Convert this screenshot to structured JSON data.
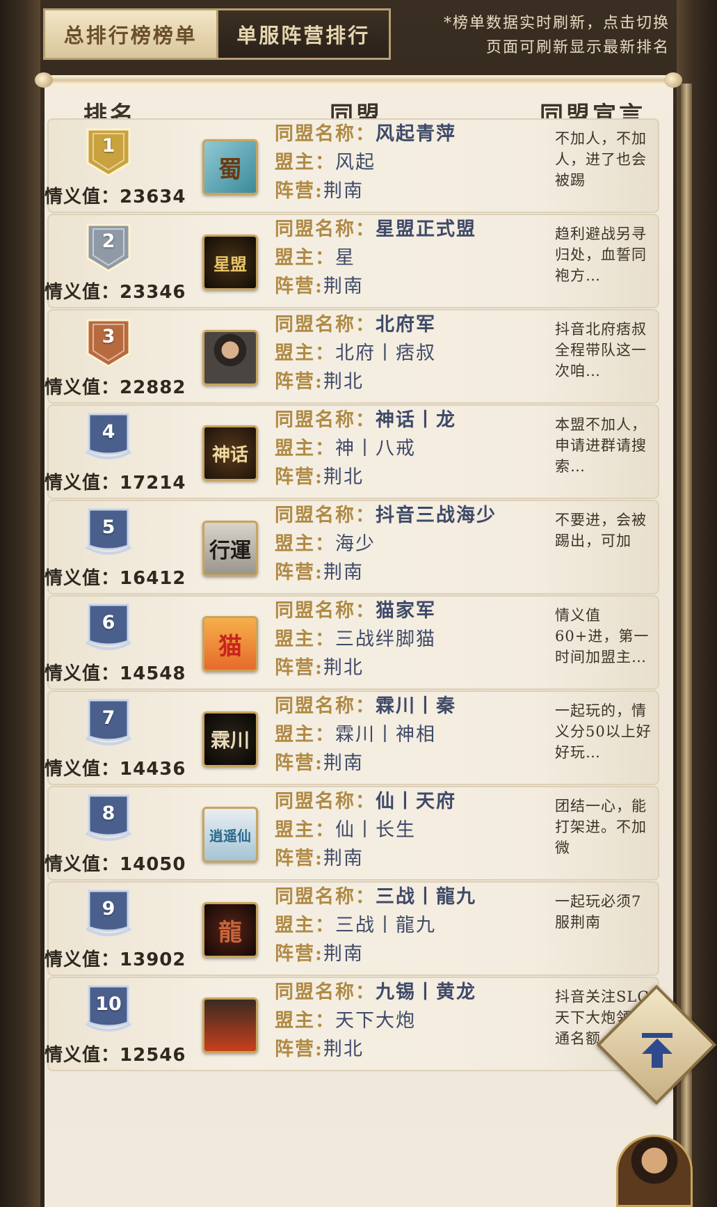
{
  "tabs": [
    {
      "label": "总排行榜榜单",
      "active": true
    },
    {
      "label": "单服阵营排行",
      "active": false
    }
  ],
  "notice_lines": [
    "*榜单数据实时刷新，点击切换",
    "页面可刷新显示最新排名"
  ],
  "columns": {
    "rank": "排名",
    "alliance": "同盟",
    "declaration": "同盟宣言"
  },
  "labels": {
    "score": "情义值：",
    "name": "同盟名称：",
    "leader": "盟主：",
    "camp": "阵营:"
  },
  "rows": [
    {
      "rank": "1",
      "score": "23634",
      "name": "风起青萍",
      "leader": "风起",
      "camp": "荆南",
      "avatar_text": "蜀",
      "avatar_icon": "shu-emblem-icon",
      "declaration": "不加人，不加人，进了也会被踢",
      "badge_color": "#c9a23e"
    },
    {
      "rank": "2",
      "score": "23346",
      "name": "星盟正式盟",
      "leader": "星",
      "camp": "荆南",
      "avatar_text": "星盟",
      "avatar_icon": "phoenix-emblem-icon",
      "declaration": "趋利避战另寻归处，血誓同袍方…",
      "badge_color": "#8f9aa6"
    },
    {
      "rank": "3",
      "score": "22882",
      "name": "北府军",
      "leader": "北府丨痞叔",
      "camp": "荆北",
      "avatar_text": "",
      "avatar_icon": "portrait-avatar-icon",
      "declaration": "抖音北府痞叔全程带队这一次咱…",
      "badge_color": "#b86a3f"
    },
    {
      "rank": "4",
      "score": "17214",
      "name": "神话丨龙",
      "leader": "神丨八戒",
      "camp": "荆北",
      "avatar_text": "神话",
      "avatar_icon": "shenhua-emblem-icon",
      "declaration": "本盟不加人，申请进群请搜索…",
      "badge_color": "#4a5f8c"
    },
    {
      "rank": "5",
      "score": "16412",
      "name": "抖音三战海少",
      "leader": "海少",
      "camp": "荆南",
      "avatar_text": "行運",
      "avatar_icon": "calligraphy-emblem-icon",
      "declaration": "不要进，会被踢出，可加",
      "badge_color": "#4a5f8c"
    },
    {
      "rank": "6",
      "score": "14548",
      "name": "猫家军",
      "leader": "三战绊脚猫",
      "camp": "荆北",
      "avatar_text": "猫",
      "avatar_icon": "cat-emblem-icon",
      "declaration": "情义值60+进，第一时间加盟主…",
      "badge_color": "#4a5f8c"
    },
    {
      "rank": "7",
      "score": "14436",
      "name": "霖川丨秦",
      "leader": "霖川丨神相",
      "camp": "荆南",
      "avatar_text": "霖川",
      "avatar_icon": "linchuan-emblem-icon",
      "declaration": "一起玩的，情义分50以上好好玩…",
      "badge_color": "#4a5f8c"
    },
    {
      "rank": "8",
      "score": "14050",
      "name": "仙丨天府",
      "leader": "仙丨长生",
      "camp": "荆南",
      "avatar_text": "逍遥仙",
      "avatar_icon": "xiaoyao-emblem-icon",
      "declaration": "团结一心，能打架进。不加微",
      "badge_color": "#4a5f8c"
    },
    {
      "rank": "9",
      "score": "13902",
      "name": "三战丨龍九",
      "leader": "三战丨龍九",
      "camp": "荆南",
      "avatar_text": "龍",
      "avatar_icon": "dragon-emblem-icon",
      "declaration": "一起玩必须7服荆南",
      "badge_color": "#4a5f8c"
    },
    {
      "rank": "10",
      "score": "12546",
      "name": "九锡丨黄龙",
      "leader": "天下大炮",
      "camp": "荆北",
      "avatar_text": "",
      "avatar_icon": "banner-fire-icon",
      "declaration": "抖音关注SLG天下大炮领绿通名额…",
      "badge_color": "#4a5f8c"
    }
  ],
  "colors": {
    "label_gold": "#b08a45",
    "value_blue": "#3f4a68",
    "paper": "#f3ecdf"
  }
}
